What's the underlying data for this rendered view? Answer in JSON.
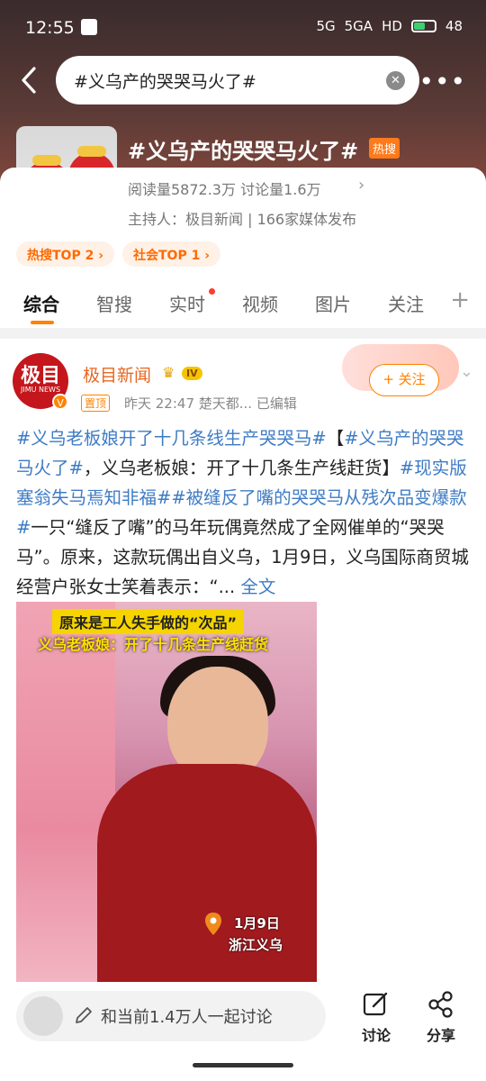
{
  "status_bar": {
    "time": "12:55",
    "battery": "48",
    "signal1": "5G",
    "signal2": "5GA",
    "hd": "HD"
  },
  "search": {
    "query": "#义乌产的哭哭马火了#"
  },
  "topic": {
    "title": "#义乌产的哭哭马火了#",
    "hot_badge": "热搜",
    "stats": "阅读量5872.3万  讨论量1.6万",
    "host": "主持人：极目新闻 | 166家媒体发布",
    "pills": [
      "热搜TOP 2 ›",
      "社会TOP 1 ›"
    ]
  },
  "tabs": [
    "综合",
    "智搜",
    "实时",
    "视频",
    "图片",
    "关注"
  ],
  "post": {
    "avatar_text": "极目",
    "avatar_sub": "JIMU NEWS",
    "author": "极目新闻",
    "level": "IV",
    "pin": "置顶",
    "meta": "昨天 22:47   楚天都...   已编辑",
    "follow": "+ 关注",
    "body": {
      "tag1": "#义乌老板娘开了十几条线生产哭哭马#",
      "text1": "【",
      "tag2": "#义乌产的哭哭马火了#",
      "text2": "，义乌老板娘：开了十几条生产线赶货】",
      "tag3": "#现实版塞翁失马焉知非福#",
      "tag4": "#被缝反了嘴的哭哭马从残次品变爆款#",
      "text3": "一只“缝反了嘴”的马年玩偶竟然成了全网催单的“哭哭马”。原来，这款玩偶出自义乌，1月9日，义乌国际商贸城经营户张女士笑着表示：“...",
      "more": "全文"
    },
    "video": {
      "caption1": "原来是工人失手做的“次品”",
      "caption2": "义乌老板娘：开了十几条生产线赶货",
      "date": "1月9日",
      "place": "浙江义乌"
    }
  },
  "bottom": {
    "comment_placeholder": "和当前1.4万人一起讨论",
    "discuss": "讨论",
    "share": "分享"
  },
  "colors": {
    "accent": "#ff8200",
    "link": "#3e7bc4",
    "author": "#e86722"
  }
}
